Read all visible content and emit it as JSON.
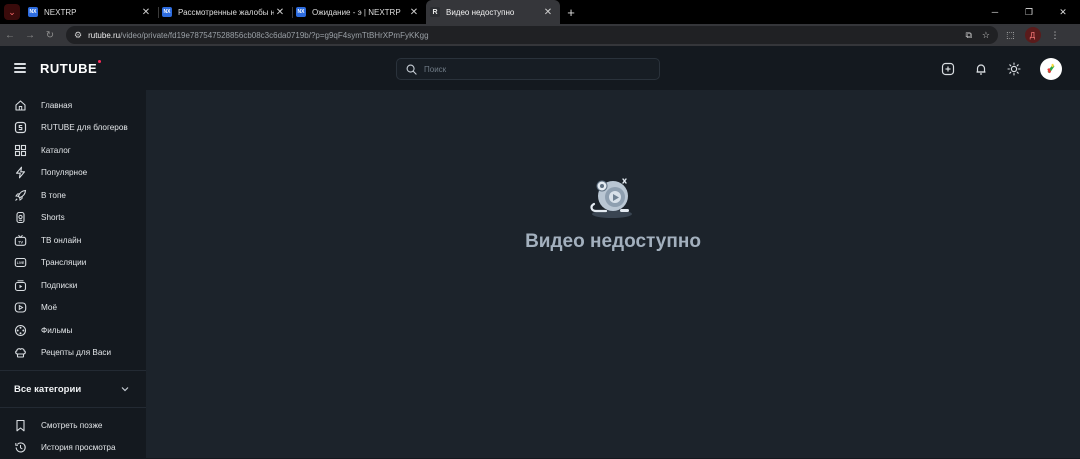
{
  "browser": {
    "tabs": [
      {
        "title": "NEXTRP",
        "favicon": "NX",
        "active": false
      },
      {
        "title": "Рассмотренные жалобы на игроков",
        "favicon": "NX",
        "active": false
      },
      {
        "title": "Ожидание - э | NEXTRP",
        "favicon": "NX",
        "active": false
      },
      {
        "title": "Видео недоступно",
        "favicon": "R",
        "active": true
      }
    ],
    "url_host": "rutube.ru",
    "url_path": "/video/private/fd19e787547528856cb08c3c6da0719b/?p=g9qF4symTtBHrXPmFyKKgg",
    "profile_letter": "Д"
  },
  "header": {
    "logo": "RUTUBE",
    "search_placeholder": "Поиск"
  },
  "sidebar": {
    "items": [
      {
        "label": "Главная",
        "icon": "home-icon"
      },
      {
        "label": "RUTUBE для блогеров",
        "icon": "studio-icon"
      },
      {
        "label": "Каталог",
        "icon": "grid-icon"
      },
      {
        "label": "Популярное",
        "icon": "lightning-icon"
      },
      {
        "label": "В топе",
        "icon": "rocket-icon"
      },
      {
        "label": "Shorts",
        "icon": "shorts-icon"
      },
      {
        "label": "ТВ онлайн",
        "icon": "tv-icon"
      },
      {
        "label": "Трансляции",
        "icon": "live-icon"
      },
      {
        "label": "Подписки",
        "icon": "subscriptions-icon"
      },
      {
        "label": "Моё",
        "icon": "my-icon"
      },
      {
        "label": "Фильмы",
        "icon": "film-icon"
      },
      {
        "label": "Рецепты для Васи",
        "icon": "chef-icon"
      }
    ],
    "categories_label": "Все категории",
    "bottom_items": [
      {
        "label": "Смотреть позже",
        "icon": "bookmark-icon"
      },
      {
        "label": "История просмотра",
        "icon": "history-icon"
      }
    ]
  },
  "main": {
    "message": "Видео недоступно"
  }
}
